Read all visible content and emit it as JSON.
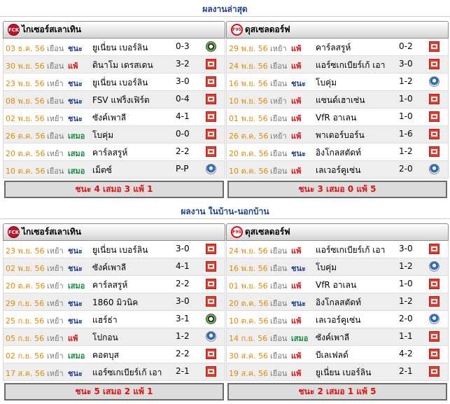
{
  "sections": [
    {
      "title": "ผลงานล่าสุด",
      "panels": [
        {
          "team": "ไกเซอร์สเลาเทิน",
          "logo": "fck-logo",
          "rows": [
            {
              "date": "03 ธ.ค. 56",
              "venue": "เยือน",
              "result": "ชนะ",
              "opponent": "ยูเนี่ยน เบอร์ลิน",
              "score": "0-3",
              "competition": "ec-icon"
            },
            {
              "date": "30 พ.ย. 56",
              "venue": "เยือน",
              "result": "แพ้",
              "opponent": "ดินาโม เดรสเดน",
              "score": "3-2",
              "competition": "dfb-icon"
            },
            {
              "date": "23 พ.ย. 56",
              "venue": "เหย้า",
              "result": "ชนะ",
              "opponent": "ยูเนี่ยน เบอร์ลิน",
              "score": "3-0",
              "competition": "dfb-icon"
            },
            {
              "date": "08 พ.ย. 56",
              "venue": "เยือน",
              "result": "ชนะ",
              "opponent": "FSV แฟร็งเฟิร์ต",
              "score": "0-4",
              "competition": "dfb-icon"
            },
            {
              "date": "02 พ.ย. 56",
              "venue": "เหย้า",
              "result": "ชนะ",
              "opponent": "ซังค์เพาลี",
              "score": "4-1",
              "competition": "dfb-icon"
            },
            {
              "date": "26 ต.ค. 56",
              "venue": "เยือน",
              "result": "เสมอ",
              "opponent": "โบคุ่ม",
              "score": "0-0",
              "competition": "dfb-icon"
            },
            {
              "date": "20 ต.ค. 56",
              "venue": "เหย้า",
              "result": "เสมอ",
              "opponent": "คาร์ลสรูห์",
              "score": "2-2",
              "competition": "dfb-icon"
            },
            {
              "date": "10 ต.ค. 56",
              "venue": "เยือน",
              "result": "เสมอ",
              "opponent": "เม็ตซ์",
              "score": "P-P",
              "competition": "fifa-icon"
            }
          ],
          "summary": "ชนะ 4 เสมอ 3 แพ้ 1"
        },
        {
          "team": "ดุสเซลดอร์ฟ",
          "logo": "f95-logo",
          "rows": [
            {
              "date": "29 พ.ย. 56",
              "venue": "เหย้า",
              "result": "แพ้",
              "opponent": "คาร์ลสรูห์",
              "score": "0-2",
              "competition": "dfb-icon"
            },
            {
              "date": "24 พ.ย. 56",
              "venue": "เยือน",
              "result": "แพ้",
              "opponent": "แอร์ซเกเบียร์เก้ เอา",
              "score": "3-0",
              "competition": "dfb-icon"
            },
            {
              "date": "16 พ.ย. 56",
              "venue": "เยือน",
              "result": "ชนะ",
              "opponent": "โบคุ่ม",
              "score": "1-2",
              "competition": "fifa-icon"
            },
            {
              "date": "10 พ.ย. 56",
              "venue": "เหย้า",
              "result": "แพ้",
              "opponent": "แซนด์เฮาเซ่น",
              "score": "1-0",
              "competition": "dfb-icon"
            },
            {
              "date": "01 พ.ย. 56",
              "venue": "เยือน",
              "result": "แพ้",
              "opponent": "VfR อาเลน",
              "score": "1-0",
              "competition": "dfb-icon"
            },
            {
              "date": "26 ต.ค. 56",
              "venue": "เหย้า",
              "result": "แพ้",
              "opponent": "พาเดอร์บอร์น",
              "score": "1-6",
              "competition": "dfb-icon"
            },
            {
              "date": "20 ต.ค. 56",
              "venue": "เยือน",
              "result": "ชนะ",
              "opponent": "อิงโกลสตัดท์",
              "score": "1-2",
              "competition": "dfb-icon"
            },
            {
              "date": "10 ต.ค. 56",
              "venue": "เยือน",
              "result": "แพ้",
              "opponent": "เลเวอร์คูเซ่น",
              "score": "2-0",
              "competition": "fifa-icon"
            }
          ],
          "summary": "ชนะ 3 เสมอ 0 แพ้ 5"
        }
      ]
    },
    {
      "title": "ผลงาน ในบ้าน-นอกบ้าน",
      "panels": [
        {
          "team": "ไกเซอร์สเลาเทิน",
          "logo": "fck-logo",
          "rows": [
            {
              "date": "23 พ.ย. 56",
              "venue": "เหย้า",
              "result": "ชนะ",
              "opponent": "ยูเนี่ยน เบอร์ลิน",
              "score": "3-0",
              "competition": "dfb-icon"
            },
            {
              "date": "02 พ.ย. 56",
              "venue": "เหย้า",
              "result": "ชนะ",
              "opponent": "ซังค์เพาลี",
              "score": "4-1",
              "competition": "dfb-icon"
            },
            {
              "date": "20 ต.ค. 56",
              "venue": "เหย้า",
              "result": "เสมอ",
              "opponent": "คาร์ลสรูห์",
              "score": "2-2",
              "competition": "dfb-icon"
            },
            {
              "date": "29 ก.ย. 56",
              "venue": "เหย้า",
              "result": "ชนะ",
              "opponent": "1860 มิวนิค",
              "score": "3-0",
              "competition": "dfb-icon"
            },
            {
              "date": "25 ก.ย. 56",
              "venue": "เหย้า",
              "result": "ชนะ",
              "opponent": "แฮร์ธ่า",
              "score": "3-1",
              "competition": "ec-icon"
            },
            {
              "date": "05 ก.ย. 56",
              "venue": "เหย้า",
              "result": "แพ้",
              "opponent": "โปกอน",
              "score": "1-2",
              "competition": "fifa-icon"
            },
            {
              "date": "02 ก.ย. 56",
              "venue": "เหย้า",
              "result": "เสมอ",
              "opponent": "คอตบุส",
              "score": "2-2",
              "competition": "dfb-icon"
            },
            {
              "date": "17 ส.ค. 56",
              "venue": "เหย้า",
              "result": "ชนะ",
              "opponent": "แอร์ซเกเบียร์เก้ เอา",
              "score": "2-1",
              "competition": "dfb-icon"
            }
          ],
          "summary": "ชนะ 5 เสมอ 2 แพ้ 1"
        },
        {
          "team": "ดุสเซลดอร์ฟ",
          "logo": "f95-logo",
          "rows": [
            {
              "date": "24 พ.ย. 56",
              "venue": "เยือน",
              "result": "แพ้",
              "opponent": "แอร์ซเกเบียร์เก้ เอา",
              "score": "3-0",
              "competition": "dfb-icon"
            },
            {
              "date": "16 พ.ย. 56",
              "venue": "เยือน",
              "result": "ชนะ",
              "opponent": "โบคุ่ม",
              "score": "1-2",
              "competition": "fifa-icon"
            },
            {
              "date": "01 พ.ย. 56",
              "venue": "เยือน",
              "result": "แพ้",
              "opponent": "VfR อาเลน",
              "score": "1-0",
              "competition": "dfb-icon"
            },
            {
              "date": "20 ต.ค. 56",
              "venue": "เยือน",
              "result": "ชนะ",
              "opponent": "อิงโกลสตัดท์",
              "score": "1-2",
              "competition": "dfb-icon"
            },
            {
              "date": "10 ต.ค. 56",
              "venue": "เยือน",
              "result": "แพ้",
              "opponent": "เลเวอร์คูเซ่น",
              "score": "2-0",
              "competition": "fifa-icon"
            },
            {
              "date": "14 ก.ย. 56",
              "venue": "เยือน",
              "result": "เสมอ",
              "opponent": "ซังค์เพาลี",
              "score": "1-1",
              "competition": "dfb-icon"
            },
            {
              "date": "30 ส.ค. 56",
              "venue": "เยือน",
              "result": "แพ้",
              "opponent": "บีเลเฟลด์",
              "score": "4-2",
              "competition": "dfb-icon"
            },
            {
              "date": "19 ส.ค. 56",
              "venue": "เยือน",
              "result": "แพ้",
              "opponent": "ยูเนี่ยน เบอร์ลิน",
              "score": "2-1",
              "competition": "dfb-icon"
            }
          ],
          "summary": "ชนะ 2 เสมอ 1 แพ้ 5"
        }
      ]
    }
  ],
  "colors": {
    "title": "#1f3f8f",
    "date": "#e08a00",
    "win": "#1f3f8f",
    "lose": "#e01010",
    "draw": "#138a3f",
    "summary": "#e01010"
  }
}
